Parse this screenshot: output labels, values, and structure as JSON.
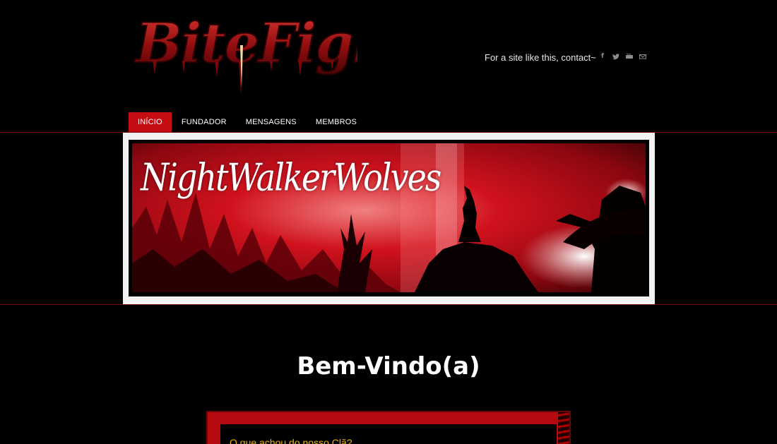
{
  "header": {
    "logo_text": "BiteFight",
    "contact_text": "For a site like this, contact~",
    "social_icons": [
      "facebook-icon",
      "twitter-icon",
      "youtube-icon",
      "mail-icon"
    ]
  },
  "nav": {
    "items": [
      {
        "label": "INÍCIO",
        "active": true
      },
      {
        "label": "FUNDADOR",
        "active": false
      },
      {
        "label": "MENSAGENS",
        "active": false
      },
      {
        "label": "MEMBROS",
        "active": false
      }
    ]
  },
  "banner": {
    "title": "NightWalkerWolves"
  },
  "main": {
    "welcome": "Bem-Vindo(a)",
    "poll_question": "O que achou do nosso Clã?"
  },
  "colors": {
    "accent_red": "#c60d14",
    "poll_text": "#e7b415",
    "background": "#000000"
  }
}
